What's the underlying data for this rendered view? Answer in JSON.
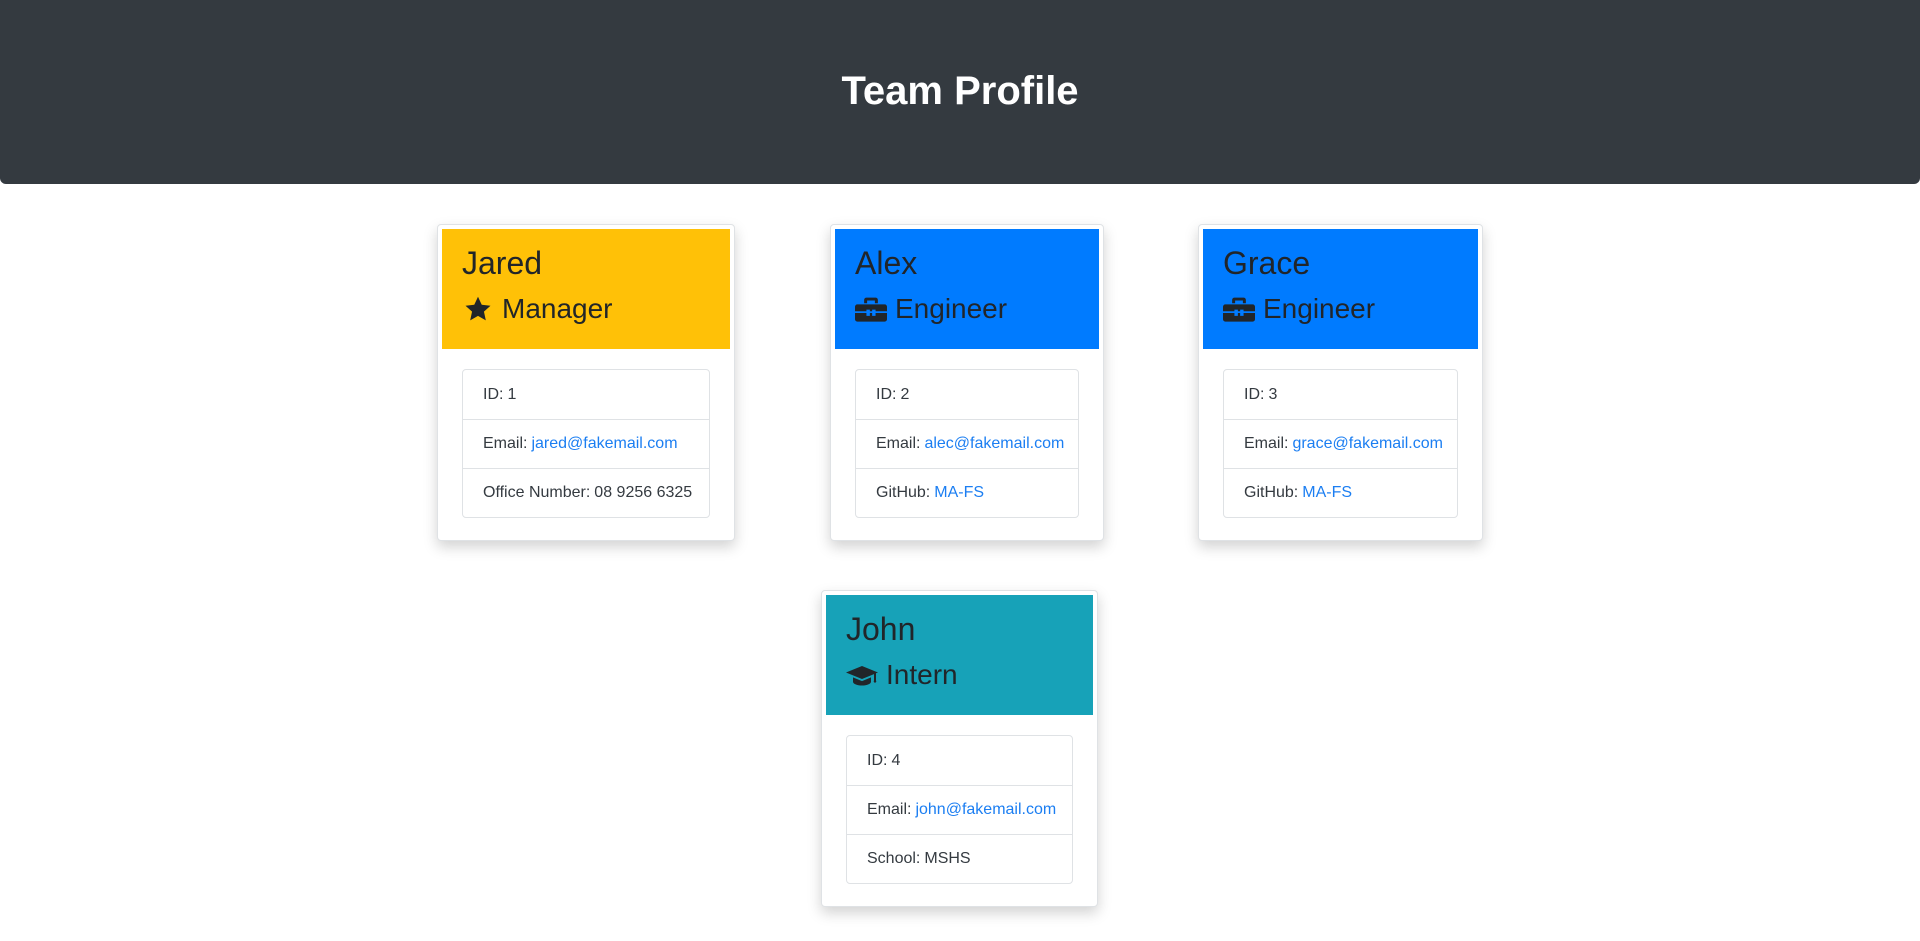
{
  "page": {
    "title": "Team Profile"
  },
  "colors": {
    "header_bg": "#343a40",
    "manager": "#ffc107",
    "engineer": "#007bff",
    "intern": "#17a2b8",
    "link": "#1b7ef2"
  },
  "team": [
    {
      "name": "Jared",
      "role": "Manager",
      "icon": "star-icon",
      "id_label": "ID:",
      "id": "1",
      "email_label": "Email:",
      "email": "jared@fakemail.com",
      "extra_label": "Office Number:",
      "extra": "08 9256 6325"
    },
    {
      "name": "Alex",
      "role": "Engineer",
      "icon": "toolbox-icon",
      "id_label": "ID:",
      "id": "2",
      "email_label": "Email:",
      "email": "alec@fakemail.com",
      "extra_label": "GitHub:",
      "extra": "MA-FS"
    },
    {
      "name": "Grace",
      "role": "Engineer",
      "icon": "toolbox-icon",
      "id_label": "ID:",
      "id": "3",
      "email_label": "Email:",
      "email": "grace@fakemail.com",
      "extra_label": "GitHub:",
      "extra": "MA-FS"
    },
    {
      "name": "John",
      "role": "Intern",
      "icon": "graduation-cap-icon",
      "id_label": "ID:",
      "id": "4",
      "email_label": "Email:",
      "email": "john@fakemail.com",
      "extra_label": "School:",
      "extra": "MSHS"
    }
  ]
}
